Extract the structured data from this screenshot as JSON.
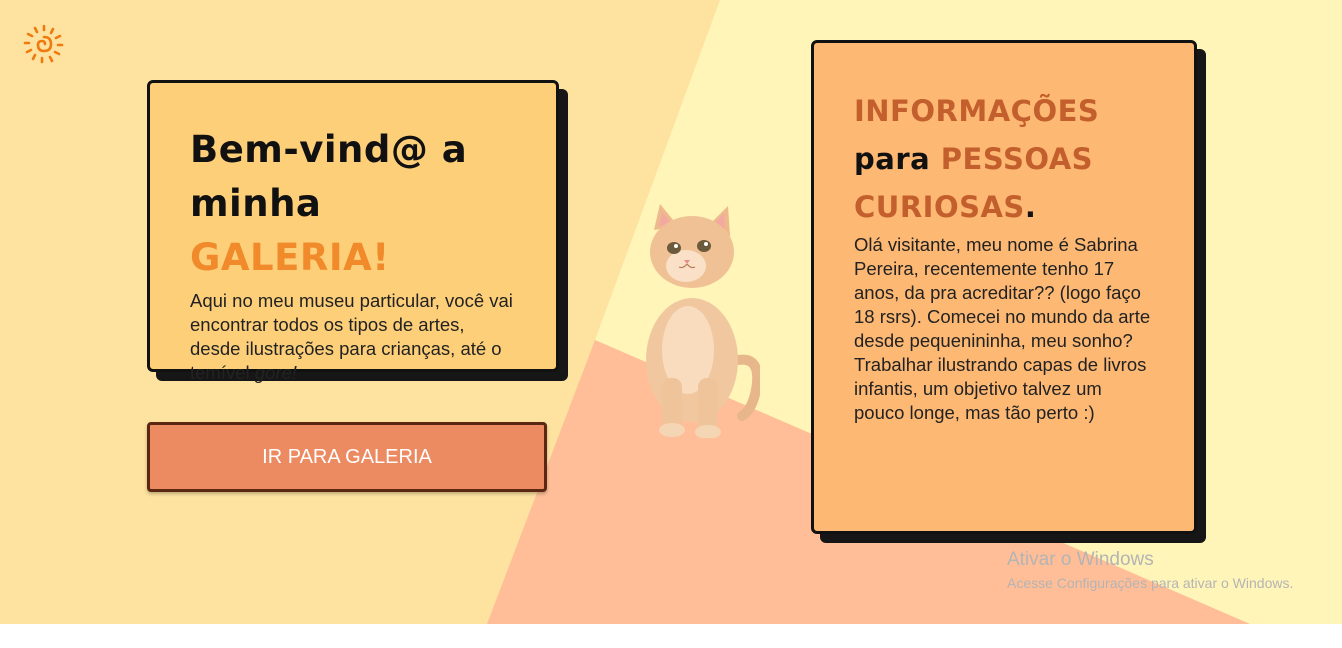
{
  "colors": {
    "background_base": "#fde39f",
    "background_light": "#fff5b8",
    "background_peach": "#ffbe98",
    "card_left": "#fecf79",
    "card_right": "#fdb873",
    "button": "#ec8b62",
    "accent_orange": "#f08a2a",
    "accent_brown": "#c35f2d"
  },
  "logo": {
    "icon": "sun-spiral-icon"
  },
  "welcome": {
    "title_part1": "Bem-vind@ a",
    "title_part2": "minha ",
    "title_highlight": "GALERIA!",
    "text_main": "Aqui no meu museu particular, você vai encontrar todos os tipos de artes, desde ilustrações para crianças, até o temível ",
    "text_emphasis": "gore!"
  },
  "cta": {
    "label": "IR PARA GALERIA"
  },
  "image": {
    "subject": "kitten-photo"
  },
  "info": {
    "title_highlight1": "INFORMAÇÕES",
    "title_plain": "para ",
    "title_highlight2": "PESSOAS CURIOSAS",
    "title_end": ".",
    "text": "Olá visitante, meu nome é Sabrina Pereira, recentemente tenho 17 anos, da pra acreditar?? (logo faço 18 rsrs). Comecei no mundo da arte desde pequenininha, meu sonho? Trabalhar ilustrando capas de livros infantis, um objetivo talvez um pouco longe, mas tão perto :)"
  },
  "watermark": {
    "title": "Ativar o Windows",
    "subtitle": "Acesse Configurações para ativar o Windows."
  }
}
